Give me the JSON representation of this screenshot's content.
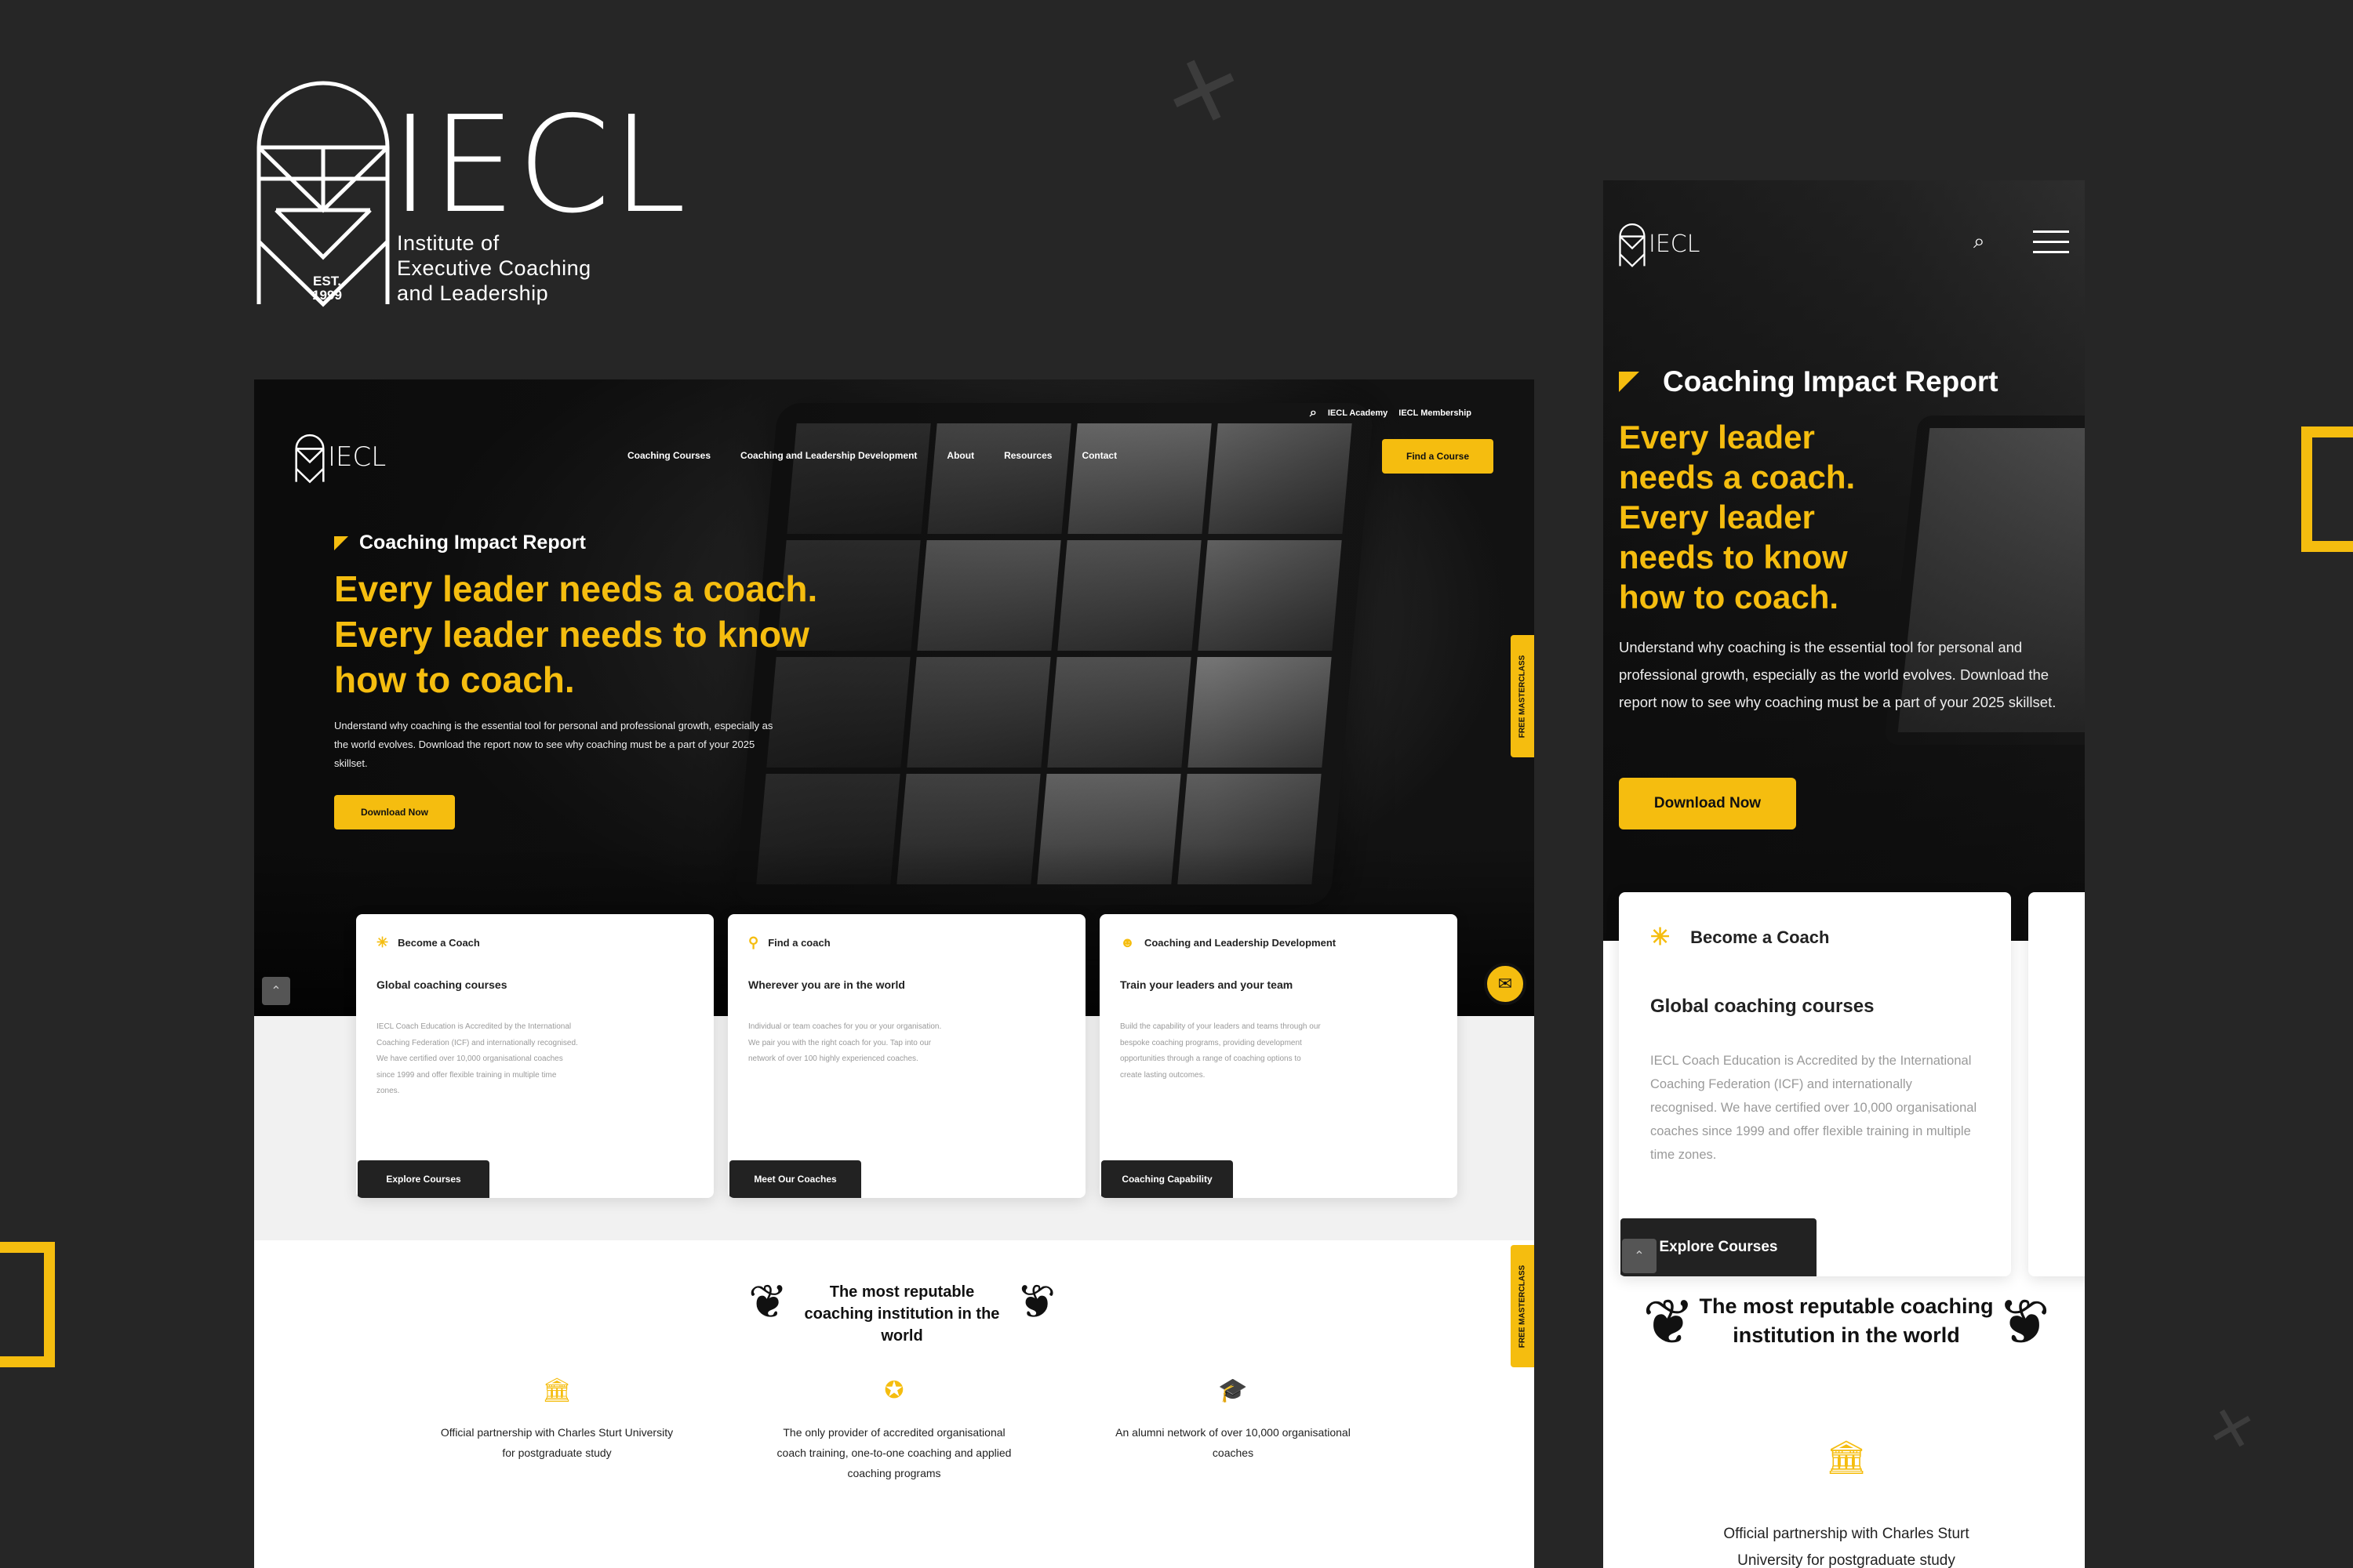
{
  "brand": {
    "wordmark": "IECL",
    "est": "EST.",
    "est_year": "1999",
    "subtitle_lines": [
      "Institute of",
      "Executive Coaching",
      "and Leadership"
    ]
  },
  "colors": {
    "accent": "#f5bd0f",
    "background": "#262626",
    "dark": "#222222"
  },
  "desktop": {
    "top_links": [
      "IECL Academy",
      "IECL Membership"
    ],
    "logo_word": "IECL",
    "nav": [
      "Coaching Courses",
      "Coaching and Leadership Development",
      "About",
      "Resources",
      "Contact"
    ],
    "find_course": "Find a Course",
    "hero": {
      "kicker": "Coaching Impact Report",
      "headline_lines": [
        "Every leader needs a coach.",
        "Every leader needs to know",
        "how to coach."
      ],
      "body": "Understand why coaching is the essential tool for personal and professional growth, especially as the world evolves. Download the report now to see why coaching must be a part of your 2025 skillset.",
      "cta": "Download Now"
    },
    "side_tab": "FREE MASTERCLASS",
    "cards": [
      {
        "label": "Become a Coach",
        "icon": "coach-icon",
        "title": "Global coaching courses",
        "text": "IECL Coach Education is Accredited by the International Coaching Federation (ICF) and internationally recognised. We have certified over 10,000 organisational coaches since 1999 and offer flexible training in multiple time zones.",
        "button": "Explore Courses"
      },
      {
        "label": "Find a coach",
        "icon": "location-pin-icon",
        "title": "Wherever you are in the world",
        "text": "Individual or team coaches for you or your organisation. We pair you with the right coach for you. Tap into our network of over 100 highly experienced coaches.",
        "button": "Meet Our Coaches"
      },
      {
        "label": "Coaching and Leadership Development",
        "icon": "team-icon",
        "title": "Train your leaders and your team",
        "text": "Build the capability of your leaders and teams through our bespoke coaching programs, providing development opportunities through a range of coaching options to create lasting outcomes.",
        "button": "Coaching Capability"
      }
    ],
    "reputation": "The most reputable coaching institution in the world",
    "features": [
      {
        "icon": "institution-icon",
        "text": "Official partnership with Charles Sturt University for postgraduate study"
      },
      {
        "icon": "award-icon",
        "text": "The only provider of accredited organisational coach training, one-to-one coaching and applied coaching programs"
      },
      {
        "icon": "graduation-cap-icon",
        "text": "An alumni network of over 10,000 organisational coaches"
      }
    ]
  },
  "mobile": {
    "logo_word": "IECL",
    "hero": {
      "kicker": "Coaching Impact Report",
      "headline_lines": [
        "Every leader",
        "needs a coach.",
        "Every leader",
        "needs to know",
        "how to coach."
      ],
      "body": "Understand why coaching is the essential tool for personal and professional growth, especially as the world evolves. Download the report now to see why coaching must be a part of your 2025 skillset.",
      "cta": "Download Now"
    },
    "card": {
      "label": "Become a Coach",
      "title": "Global coaching courses",
      "text": "IECL Coach Education is Accredited by the International Coaching Federation (ICF) and internationally recognised. We have certified over 10,000 organisational coaches since 1999 and offer flexible training in multiple time zones.",
      "button": "Explore Courses"
    },
    "reputation": "The most reputable coaching institution in the world",
    "feature": "Official partnership with Charles Sturt University for postgraduate study"
  }
}
